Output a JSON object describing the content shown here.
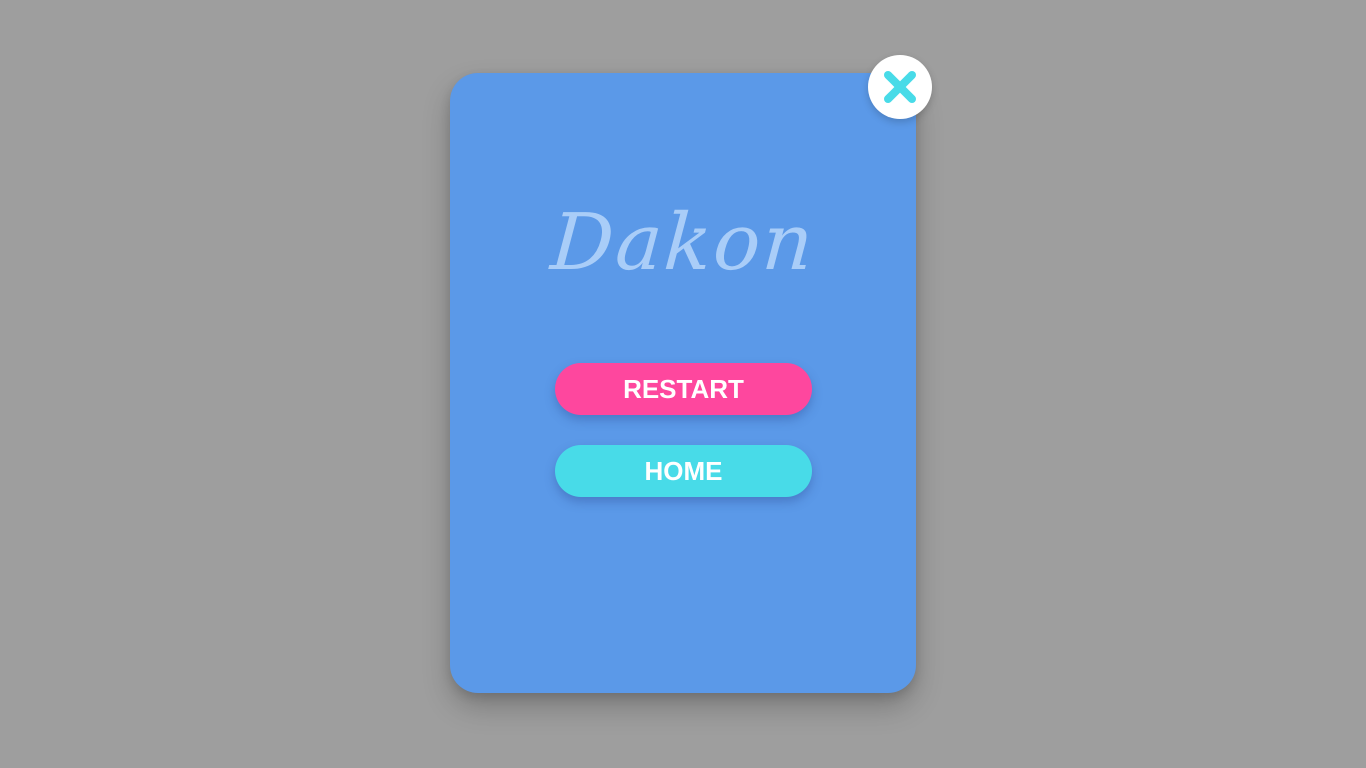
{
  "game": {
    "title": "Dakon"
  },
  "menu": {
    "restart_label": "RESTART",
    "home_label": "HOME"
  },
  "icons": {
    "close": "close-icon"
  },
  "colors": {
    "backdrop": "#9e9e9e",
    "panel": "#5b99e8",
    "title": "#a9cdf8",
    "restart": "#fe479e",
    "home": "#48dbe8",
    "close_icon": "#48dbe8"
  }
}
